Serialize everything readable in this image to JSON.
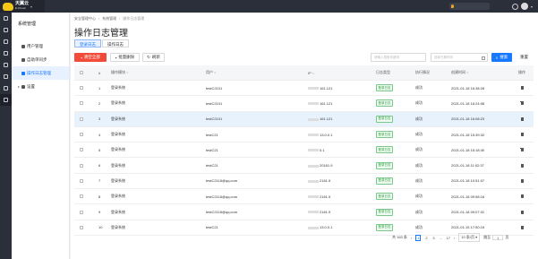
{
  "brand": {
    "name": "天翼云",
    "sub": "E-Cloud"
  },
  "sidenav": {
    "title": "系统管理",
    "items": [
      {
        "label": "用户管理",
        "icon": "user-icon"
      },
      {
        "label": "自助单同步",
        "icon": "list-icon"
      },
      {
        "label": "操作日志管理",
        "icon": "log-icon"
      },
      {
        "label": "设置",
        "icon": "settings-icon"
      }
    ]
  },
  "breadcrumb": [
    "安全管理中心",
    "系统管理",
    "操作日志管理"
  ],
  "page_title": "操作日志管理",
  "tabs": [
    "登录日志",
    "操作日志"
  ],
  "toolbar": {
    "clear_all": "清空全部",
    "batch_delete": "批量删除",
    "refresh": "刷新",
    "search_placeholder": "请输入搜索关键词",
    "date_placeholder": "选择日期时间",
    "search": "搜索",
    "reset": "重置"
  },
  "table": {
    "columns": [
      "#",
      "操作模块",
      "用户",
      "IP",
      "日志类型",
      "执行情况",
      "创建时间",
      "操作"
    ],
    "rows": [
      {
        "no": "1",
        "module": "登录系统",
        "user": "testC2101",
        "ip": "161.121",
        "type": "登录日志",
        "result": "成功",
        "time": "2021-01-18 16:38:28"
      },
      {
        "no": "2",
        "module": "登录系统",
        "user": "testC2101",
        "ip": "161.121",
        "type": "登录日志",
        "result": "成功",
        "time": "2021-01-18 16:24:08"
      },
      {
        "no": "3",
        "module": "登录系统",
        "user": "testC2101",
        "ip": "161.121",
        "type": "登录日志",
        "result": "成功",
        "time": "2021-01-18 16:08:23"
      },
      {
        "no": "4",
        "module": "登录系统",
        "user": "testC21",
        "ip": "13.0.0.1",
        "type": "登录日志",
        "result": "成功",
        "time": "2021-01-18 15:39:32"
      },
      {
        "no": "5",
        "module": "登录系统",
        "user": "testC21",
        "ip": "0.1",
        "type": "登录日志",
        "result": "成功",
        "time": "2021-01-18 15:18:30"
      },
      {
        "no": "6",
        "module": "登录系统",
        "user": "testC21",
        "ip": "20161.9",
        "type": "登录日志",
        "result": "成功",
        "time": "2021-01-18 11:02:37"
      },
      {
        "no": "7",
        "module": "登录系统",
        "user": "testC2118@qq.com",
        "ip": "2161.9",
        "type": "登录日志",
        "result": "成功",
        "time": "2021-01-18 10:51:07"
      },
      {
        "no": "8",
        "module": "登录系统",
        "user": "testC2118@qq.com",
        "ip": "2161.9",
        "type": "登录日志",
        "result": "成功",
        "time": "2021-01-18 09:58:16"
      },
      {
        "no": "9",
        "module": "登录系统",
        "user": "testC2118@qq.com",
        "ip": "2161.9",
        "type": "登录日志",
        "result": "成功",
        "time": "2021-01-18 09:07:31"
      },
      {
        "no": "10",
        "module": "登录系统",
        "user": "testC21",
        "ip": "13.0.0.1",
        "type": "登录日志",
        "result": "成功",
        "time": "2021-01-15 17:50:15"
      }
    ]
  },
  "pagination": {
    "total": "共 163 条",
    "pages": [
      "1",
      "2",
      "3",
      "...",
      "17"
    ],
    "page_size": "10 条/页",
    "jump_label": "跳至",
    "jump_value": "1",
    "page_unit": "页"
  }
}
